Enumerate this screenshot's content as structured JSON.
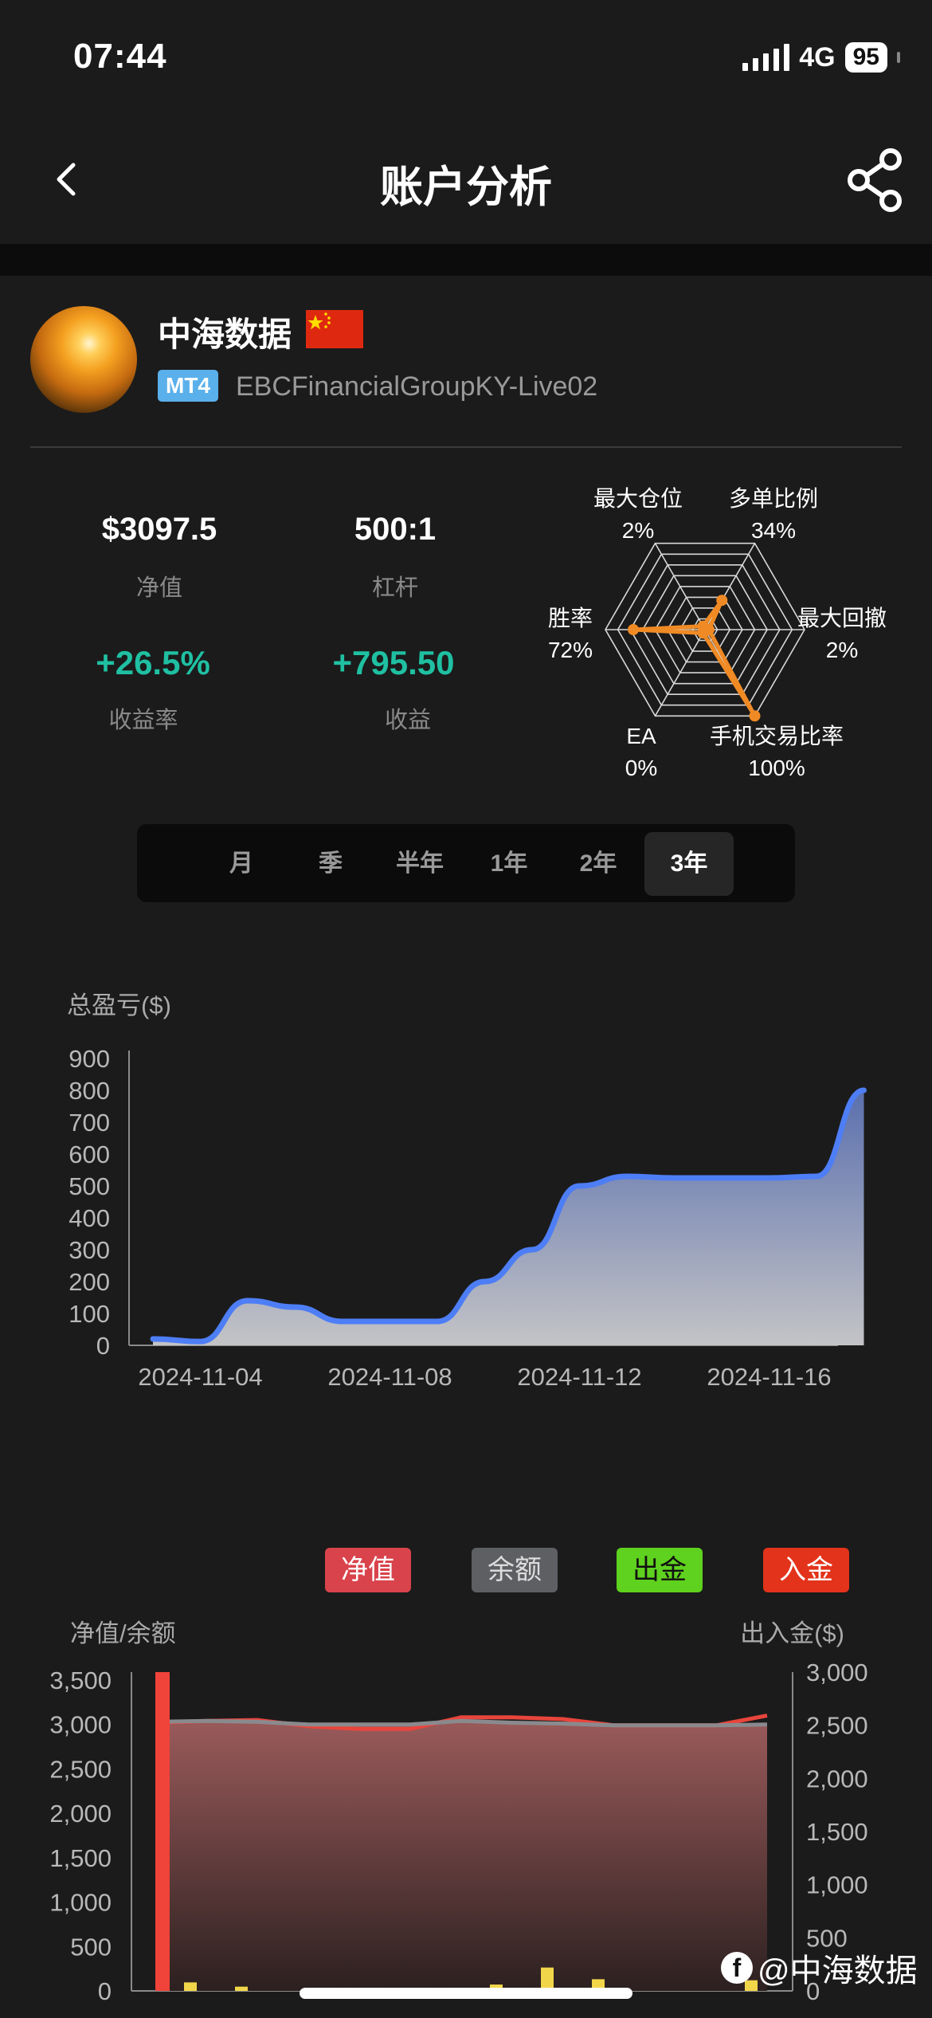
{
  "status_bar": {
    "time": "07:44",
    "network": "4G",
    "battery": "95"
  },
  "header": {
    "title": "账户分析"
  },
  "profile": {
    "name": "中海数据",
    "platform": "MT4",
    "account": "EBCFinancialGroupKY-Live02"
  },
  "stats": {
    "equity_value": "$3097.5",
    "equity_label": "净值",
    "leverage_value": "500:1",
    "leverage_label": "杠杆",
    "return_value": "+26.5%",
    "return_label": "收益率",
    "profit_value": "+795.50",
    "profit_label": "收益"
  },
  "radar": {
    "axes": [
      {
        "name": "最大仓位",
        "value": "2%",
        "pct": 2
      },
      {
        "name": "多单比例",
        "value": "34%",
        "pct": 34
      },
      {
        "name": "最大回撤",
        "value": "2%",
        "pct": 2
      },
      {
        "name": "手机交易比率",
        "value": "100%",
        "pct": 100
      },
      {
        "name": "EA",
        "value": "0%",
        "pct": 0
      },
      {
        "name": "胜率",
        "value": "72%",
        "pct": 72
      }
    ],
    "color": "#f08a24"
  },
  "periods": {
    "tabs": [
      "月",
      "季",
      "半年",
      "1年",
      "2年",
      "3年"
    ],
    "active": "3年"
  },
  "pnl_chart": {
    "ylabel": "总盈亏($)",
    "y_ticks": [
      "900",
      "800",
      "700",
      "600",
      "500",
      "400",
      "300",
      "200",
      "100",
      "0"
    ],
    "x_ticks": [
      "2024-11-04",
      "2024-11-08",
      "2024-11-12",
      "2024-11-16"
    ]
  },
  "legend": {
    "equity": "净值",
    "balance": "余额",
    "withdraw": "出金",
    "deposit": "入金",
    "colors": {
      "equity": "#d9434b",
      "balance": "#5e5f63",
      "withdraw": "#5fd11f",
      "deposit": "#e3331b"
    }
  },
  "balance_chart": {
    "left_label": "净值/余额",
    "right_label": "出入金($)",
    "left_ticks": [
      "3,500",
      "3,000",
      "2,500",
      "2,000",
      "1,500",
      "1,000",
      "500",
      "0"
    ],
    "right_ticks": [
      "3,000",
      "2,500",
      "2,000",
      "1,500",
      "1,000",
      "500",
      "0"
    ]
  },
  "watermark": "@中海数据",
  "chart_data": [
    {
      "type": "area",
      "ylabel": "总盈亏($)",
      "ylim": [
        0,
        900
      ],
      "x": [
        "2024-11-03",
        "2024-11-04",
        "2024-11-05",
        "2024-11-06",
        "2024-11-07",
        "2024-11-08",
        "2024-11-09",
        "2024-11-10",
        "2024-11-11",
        "2024-11-12",
        "2024-11-13",
        "2024-11-14",
        "2024-11-15",
        "2024-11-16",
        "2024-11-17",
        "2024-11-18"
      ],
      "series": [
        {
          "values": [
            20,
            12,
            140,
            120,
            75,
            75,
            75,
            200,
            300,
            500,
            530,
            525,
            525,
            525,
            530,
            800
          ]
        }
      ],
      "x_ticks": [
        "2024-11-04",
        "2024-11-08",
        "2024-11-12",
        "2024-11-16"
      ]
    },
    {
      "type": "area",
      "ylabel": "净值/余额",
      "ylim": [
        0,
        3500
      ],
      "y2label": "出入金($)",
      "y2lim": [
        0,
        3000
      ],
      "series": [
        {
          "name": "净值",
          "values": [
            3020,
            3040,
            3050,
            2980,
            2950,
            2950,
            3080,
            3080,
            3060,
            2990,
            2990,
            2990,
            3100
          ]
        },
        {
          "name": "余额",
          "values": [
            3030,
            3040,
            3030,
            3000,
            3000,
            3000,
            3040,
            3020,
            3010,
            2990,
            2990,
            2990,
            3000
          ]
        },
        {
          "name": "入金",
          "values": [
            3000,
            80,
            40,
            0,
            0,
            0,
            0,
            60,
            220,
            110,
            0,
            0,
            100
          ]
        }
      ]
    }
  ]
}
